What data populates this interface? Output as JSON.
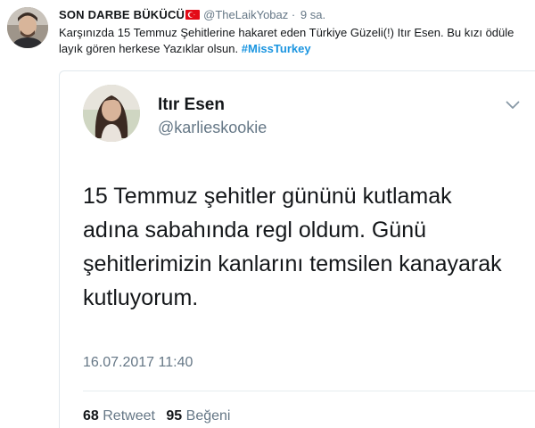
{
  "outer_tweet": {
    "display_name": "SON DARBE BÜKÜCÜ",
    "handle": "@TheLaikYobaz",
    "separator": "·",
    "time": "9 sa.",
    "text": "Karşınızda 15 Temmuz Şehitlerine hakaret eden Türkiye Güzeli(!) Itır Esen. Bu kızı ödüle layık gören herkese Yazıklar olsun.",
    "hashtag": "#MissTurkey"
  },
  "quoted_tweet": {
    "display_name": "Itır Esen",
    "handle": "@karlieskookie",
    "text": "15 Temmuz şehitler gününü kutlamak adına sabahında regl oldum. Günü şehitlerimizin kanlarını temsilen kanayarak kutluyorum.",
    "date": "16.07.2017 11:40",
    "retweet_count": "68",
    "retweet_label": "Retweet",
    "like_count": "95",
    "like_label": "Beğeni"
  },
  "colors": {
    "link": "#1b95e0",
    "secondary_text": "#657786",
    "flag_red": "#e30a17"
  },
  "icons": [
    "turkey-flag-icon",
    "chevron-down-icon"
  ]
}
